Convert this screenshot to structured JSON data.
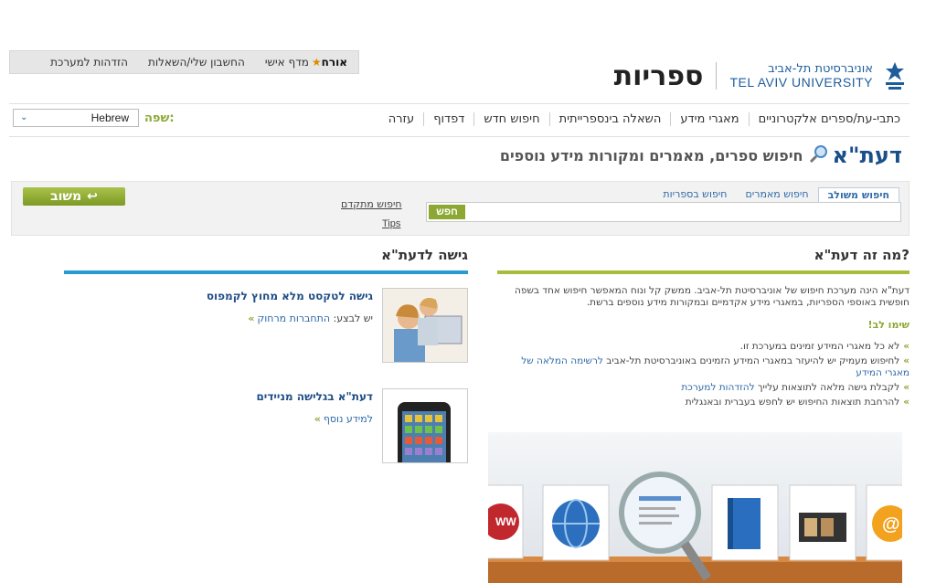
{
  "userbar": {
    "guest": "אורח",
    "shelf": "מדף אישי",
    "account": "החשבון שלי/השאלות",
    "login": "הזדהות למערכת"
  },
  "header": {
    "university_he": "אוניברסיטת תל-אביב",
    "university_en": "TEL AVIV UNIVERSITY",
    "libraries": "ספריות"
  },
  "nav": {
    "items": [
      "כתבי-עת/ספרים אלקטרוניים",
      "מאגרי מידע",
      "השאלה בינספרייתית",
      "חיפוש חדש",
      "דפדוף",
      "עזרה"
    ]
  },
  "language": {
    "label": "שפה:",
    "selected": "Hebrew"
  },
  "daat": {
    "brand": "דעת\"א",
    "tagline": "חיפוש ספרים, מאמרים ומקורות מידע נוספים"
  },
  "search": {
    "tabs": [
      "חיפוש משולב",
      "חיפוש מאמרים",
      "חיפוש בספריות"
    ],
    "go_label": "חפש",
    "advanced": "חיפוש מתקדם",
    "tips": "Tips",
    "feedback": "משוב"
  },
  "about": {
    "title": "מה זה דעת\"א?",
    "description": "דעת\"א הינה מערכת חיפוש של אוניברסיטת תל-אביב. ממשק קל ונוח המאפשר חיפוש אחד בשפה חופשית באוספי הספריות, במאגרי מידע אקדמיים ובמקורות מידע נוספים ברשת.",
    "note": "שימו לב!",
    "bullets": [
      {
        "text": "לא כל מאגרי המידע זמינים במערכת זו.",
        "link": ""
      },
      {
        "text": "לחיפוש מעמיק יש להיעזר במאגרי המידע הזמינים באוניברסיטת תל-אביב ",
        "link": "לרשימה המלאה של מאגרי המידע"
      },
      {
        "text": "לקבלת גישה מלאה לתוצאות עלייך ",
        "link": "להזדהות למערכת"
      },
      {
        "text": "להרחבת תוצאות החיפוש יש לחפש בעברית ובאנגלית",
        "link": ""
      }
    ]
  },
  "access": {
    "title": "גישה לדעת\"א",
    "cards": [
      {
        "title": "גישה לטקסט מלא מחוץ לקמפוס",
        "sub_text": "יש לבצע: ",
        "sub_link": "התחברות מרחוק"
      },
      {
        "title": "דעת\"א בגלישה מניידים",
        "sub_text": "",
        "sub_link": "למידע נוסף"
      }
    ]
  },
  "colors": {
    "green": "#8ca832",
    "blue": "#2a9bd1",
    "link": "#2e6aa8"
  }
}
